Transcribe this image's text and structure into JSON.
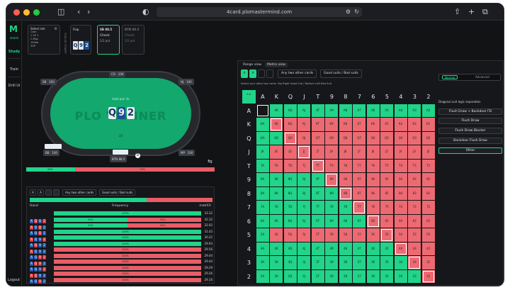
{
  "browser": {
    "url": "4card.plomastermind.com"
  },
  "sidebar": {
    "brand": "atable",
    "items": [
      {
        "label": "Study",
        "active": true
      },
      {
        "label": "Train",
        "active": false
      },
      {
        "label": "Drill Ui",
        "active": false
      }
    ],
    "logout": "Logout"
  },
  "sim": {
    "title": "Select sim",
    "options": [
      "Cash",
      "1 VS 1",
      "C-Max",
      "100bb",
      "3OP"
    ]
  },
  "street_label": "TURN BY STREET",
  "flop": {
    "title": "Flop",
    "cards": [
      {
        "rank": "Q",
        "dark": false
      },
      {
        "rank": "9",
        "dark": false
      },
      {
        "rank": "2",
        "dark": true
      }
    ]
  },
  "actions": [
    {
      "header": "SB  88.5",
      "action": "Check",
      "sub": "2/3 pot",
      "selected": true,
      "dim": false
    },
    {
      "header": "BTN  88.5",
      "action": "Check",
      "sub": "1/2 pot",
      "selected": false,
      "dim": true
    }
  ],
  "table": {
    "pot_label": "total pot: 4s",
    "watermark": "PLO TRAINER",
    "board": [
      {
        "rank": "Q",
        "dark": false
      },
      {
        "rank": "9",
        "dark": true
      },
      {
        "rank": "2",
        "dark": false
      }
    ],
    "center_value": "24",
    "seats": [
      {
        "label": "SB",
        "stack": "100"
      },
      {
        "label": "CO",
        "stack": "100"
      },
      {
        "label": "HJ",
        "stack": "100"
      },
      {
        "label": "MP",
        "stack": "100"
      },
      {
        "label": "BB",
        "stack": "100"
      },
      {
        "label": "BTN",
        "stack": "88.5"
      }
    ]
  },
  "freq_summary": {
    "green_pct": 26,
    "green_label": "26%",
    "red_label": "74%"
  },
  "hand_panel": {
    "filter_any": "Any two other cards",
    "filter_suits": "Good suits / Bad suits",
    "columns": {
      "hand": "Hand",
      "frequency": "Frequency",
      "ev": "matrEV"
    },
    "rows": [
      {
        "cards": [
          "A",
          "Q",
          "Q",
          "2"
        ],
        "reds": [
          1,
          3
        ],
        "green": 100,
        "gl": "100%",
        "rl": "",
        "ev": "33.32"
      },
      {
        "cards": [
          "A",
          "Q",
          "Q",
          "2"
        ],
        "reds": [
          0,
          2
        ],
        "green": 50,
        "gl": "50%",
        "rl": "50%",
        "ev": "32.32"
      },
      {
        "cards": [
          "A",
          "Q",
          "Q",
          "2"
        ],
        "reds": [
          2
        ],
        "green": 50,
        "gl": "50%",
        "rl": "50%",
        "ev": "32.02"
      },
      {
        "cards": [
          "A",
          "Q",
          "9",
          "2"
        ],
        "reds": [
          0,
          3
        ],
        "green": 100,
        "gl": "100%",
        "rl": "",
        "ev": "31.43"
      },
      {
        "cards": [
          "A",
          "Q",
          "9",
          "2"
        ],
        "reds": [
          1
        ],
        "green": 100,
        "gl": "100%",
        "rl": "",
        "ev": "30.22"
      },
      {
        "cards": [
          "A",
          "Q",
          "9",
          "2"
        ],
        "reds": [
          0
        ],
        "green": 100,
        "gl": "100%",
        "rl": "",
        "ev": "29.93"
      },
      {
        "cards": [
          "A",
          "Q",
          "9",
          "2"
        ],
        "reds": [
          2,
          3
        ],
        "green": 0,
        "gl": "",
        "rl": "100%",
        "ev": "29.56"
      },
      {
        "cards": [
          "A",
          "Q",
          "9",
          "2"
        ],
        "reds": [
          1,
          2
        ],
        "green": 0,
        "gl": "",
        "rl": "100%",
        "ev": "29.44"
      },
      {
        "cards": [
          "A",
          "Q",
          "9",
          "2"
        ],
        "reds": [
          3
        ],
        "green": 0,
        "gl": "",
        "rl": "100%",
        "ev": "29.44"
      },
      {
        "cards": [
          "A",
          "Q",
          "9",
          "2"
        ],
        "reds": [
          0,
          1
        ],
        "green": 0,
        "gl": "",
        "rl": "100%",
        "ev": "29.29"
      },
      {
        "cards": [
          "A",
          "Q",
          "9",
          "2"
        ],
        "reds": [
          2
        ],
        "green": 0,
        "gl": "",
        "rl": "100%",
        "ev": "29.26"
      },
      {
        "cards": [
          "A",
          "Q",
          "9",
          "2"
        ],
        "reds": [
          1,
          3
        ],
        "green": 0,
        "gl": "",
        "rl": "100%",
        "ev": "29.16"
      }
    ]
  },
  "matrix": {
    "tabs": [
      {
        "label": "Range view",
        "selected": false
      },
      {
        "label": "Matrix view",
        "selected": true
      }
    ],
    "card_chips": [
      "A",
      "A"
    ],
    "filter_any": "Any two other cards",
    "filter_suits": "Good suits / Bad suits",
    "instruction": "Select your other two cards. Top Right Good Suit / Bottom Left Bad Suit",
    "corner": "A A",
    "ranks": [
      "A",
      "K",
      "Q",
      "J",
      "T",
      "9",
      "8",
      "7",
      "6",
      "5",
      "4",
      "3",
      "2"
    ],
    "cells": [
      "GGGGGGGGGGGGG",
      "GRRRRRRRRRRRR",
      "GGRRRRRRRRRRR",
      "GRRRRRRRRRRRR",
      "GRRRRRRRRRRRR",
      "GGGGGRRRRRRRR",
      "GGGGGGRRRRRRR",
      "GGGGGGGRRRRRR",
      "GGGGGGGGRRRRR",
      "GRRRRRRRRRRRR",
      "GGGGGGGGGGRRR",
      "GGGGGGGGGGGRR",
      "GGGGGGGGGGGGR"
    ]
  },
  "side": {
    "mode_normal": "Normal",
    "mode_advanced": "Advanced",
    "section_label": "Diagonal suit logic separation",
    "buttons": [
      {
        "label": "Flush Draw + Backdoor FD",
        "selected": false
      },
      {
        "label": "Flush Draw",
        "selected": false
      },
      {
        "label": "Flush Draw Blocker",
        "selected": false
      },
      {
        "label": "Backdoor Flush Draw",
        "selected": false
      },
      {
        "label": "Other",
        "selected": true
      }
    ]
  },
  "colors": {
    "accent": "#21d48a",
    "loss": "#ee6a73",
    "bg": "#121315"
  }
}
